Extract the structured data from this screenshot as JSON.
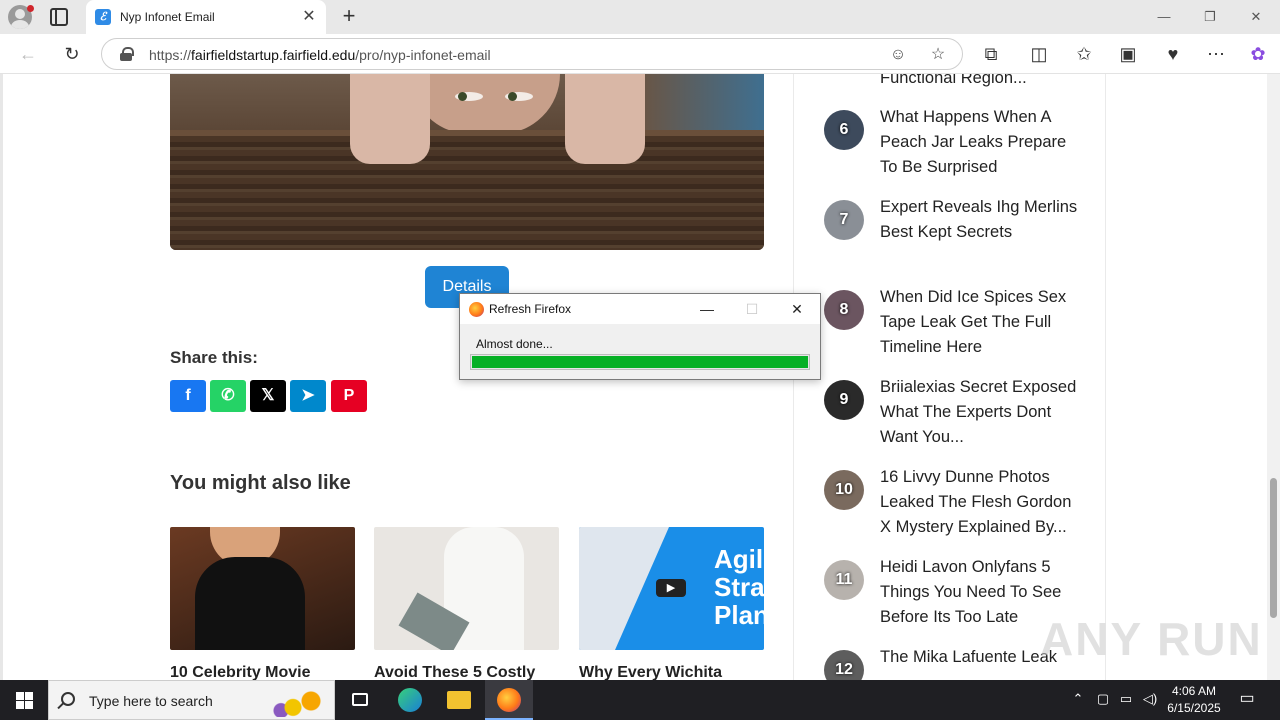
{
  "browser": {
    "tab_title": "Nyp Infonet Email",
    "tab_favicon_letter": "ℰ",
    "tab_close": "✕",
    "new_tab": "+",
    "url_prefix": "https://",
    "url_host": "fairfieldstartup.fairfield.edu",
    "url_path": "/pro/nyp-infonet-email",
    "window_controls": {
      "minimize": "—",
      "restore": "❐",
      "close": "✕"
    }
  },
  "article": {
    "details_button": "Details",
    "share_title": "Share this:",
    "share_buttons": [
      {
        "icon": "facebook-icon",
        "glyph": "f",
        "color": "#1877f2"
      },
      {
        "icon": "whatsapp-icon",
        "glyph": "✆",
        "color": "#25d366"
      },
      {
        "icon": "x-icon",
        "glyph": "𝕏",
        "color": "#000000"
      },
      {
        "icon": "telegram-icon",
        "glyph": "➤",
        "color": "#0088cc"
      },
      {
        "icon": "pinterest-icon",
        "glyph": "P",
        "color": "#e60023"
      }
    ],
    "related_title": "You might also like",
    "cards": [
      {
        "title": "10 Celebrity Movie"
      },
      {
        "title": "Avoid These 5 Costly"
      },
      {
        "title": "Why Every Wichita",
        "image_text": "Agil Strateg Plan"
      }
    ]
  },
  "sidebar": {
    "top_partial": "Functional Region...",
    "items": [
      {
        "rank": "6",
        "title": "What Happens When A Peach Jar Leaks Prepare To Be Surprised",
        "badge_color": "#3d4a5c"
      },
      {
        "rank": "7",
        "title": "Expert Reveals Ihg Merlins Best Kept Secrets",
        "badge_color": "#8a8f96"
      },
      {
        "rank": "8",
        "title": "When Did Ice Spices Sex Tape Leak Get The Full Timeline Here",
        "badge_color": "#6b5560"
      },
      {
        "rank": "9",
        "title": "Briialexias Secret Exposed What The Experts Dont Want You...",
        "badge_color": "#2a2a2a"
      },
      {
        "rank": "10",
        "title": "16 Livvy Dunne Photos Leaked The Flesh Gordon X Mystery Explained By...",
        "badge_color": "#7a6a5e"
      },
      {
        "rank": "11",
        "title": "Heidi Lavon Onlyfans 5 Things You Need To See Before Its Too Late",
        "badge_color": "#b7b2ad"
      },
      {
        "rank": "12",
        "title": "The Mika Lafuente Leak",
        "badge_color": "#5d5d5d"
      }
    ]
  },
  "dialog": {
    "title": "Refresh Firefox",
    "status": "Almost done...",
    "progress_fraction": 1.0,
    "progress_color": "#06b025",
    "min": "—",
    "max": "☐",
    "close": "✕"
  },
  "watermark": "ANY RUN",
  "taskbar": {
    "search_placeholder": "Type here to search",
    "time": "4:06 AM",
    "date": "6/15/2025"
  }
}
